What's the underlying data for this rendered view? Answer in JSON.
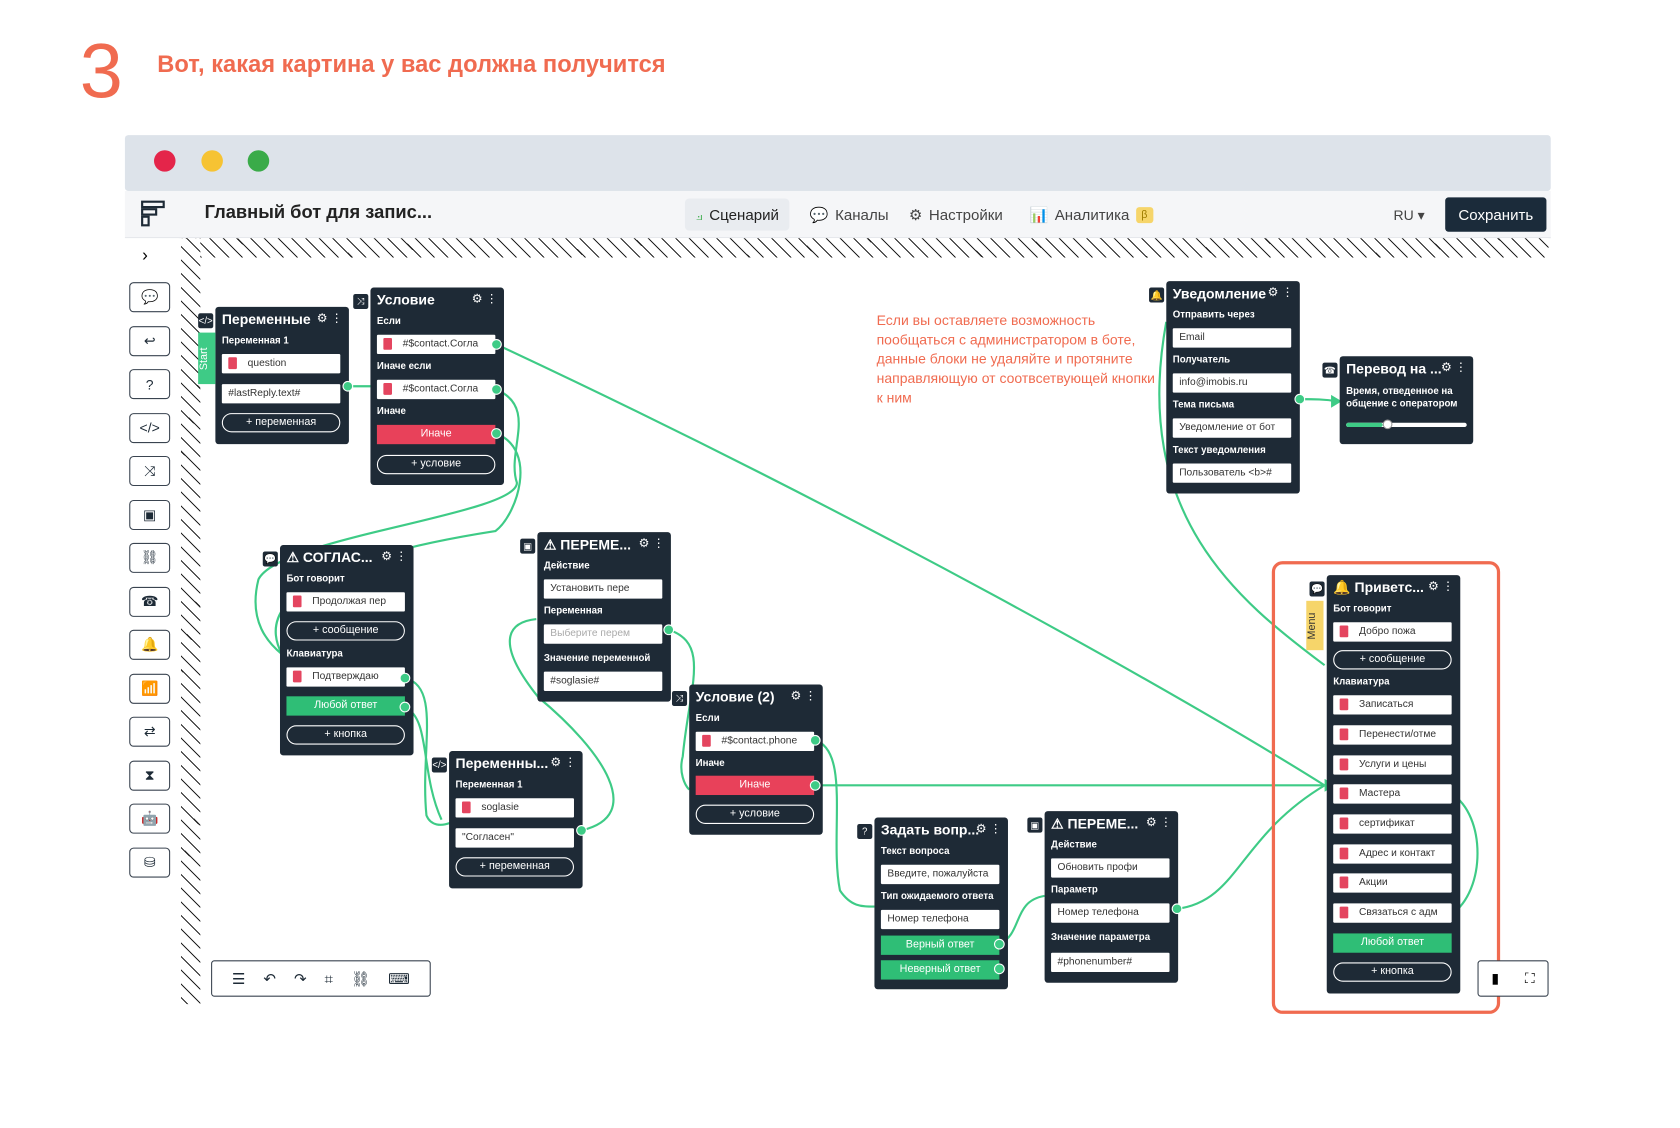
{
  "step": {
    "number": "3",
    "heading": "Вот, какая картина у вас должна получится"
  },
  "window": {
    "dots": [
      "#e4254a",
      "#f6c333",
      "#3aab49"
    ]
  },
  "app": {
    "title": "Главный бот для запис...",
    "tabs": [
      {
        "label": "Сценарий",
        "active": true,
        "icon": "scenario-icon"
      },
      {
        "label": "Каналы",
        "active": false,
        "icon": "chat-icon"
      },
      {
        "label": "Настройки",
        "active": false,
        "icon": "gear-icon"
      },
      {
        "label": "Аналитика",
        "active": false,
        "icon": "chart-icon",
        "badge": "β"
      }
    ],
    "lang": "RU",
    "save": "Сохранить"
  },
  "sidebar": [
    "›",
    "💬",
    "↩",
    "?",
    "</>",
    "⤨",
    "▣",
    "⛓",
    "☎",
    "🔔",
    "📶",
    "⇄",
    "⧗",
    "🤖",
    "⛁"
  ],
  "note": "Если вы оставляете возможность пообщаться с администратором в боте, данные блоки не удаляйте и протяните направляющую от соотвсетвующей кнопки к ним",
  "nodes": {
    "vars1": {
      "title": "Переменные",
      "label1": "Переменная 1",
      "f1": "question",
      "f2": "#lastReply.text#",
      "btn": "+ переменная",
      "flag": "Start"
    },
    "cond1": {
      "title": "Условие",
      "l_if": "Если",
      "f_if": "#$contact.Согла",
      "l_elif": "Иначе если",
      "f_elif": "#$contact.Согла",
      "l_else": "Иначе",
      "else": "Иначе",
      "btn": "+ условие"
    },
    "agree": {
      "title": "СОГЛАС...",
      "l1": "Бот говорит",
      "f1": "Продолжая пер",
      "btn1": "+ сообщение",
      "l2": "Клавиатура",
      "f2": "Подтверждаю",
      "any": "Любой ответ",
      "btn2": "+ кнопка"
    },
    "vars2": {
      "title": "ПЕРЕМЕ...",
      "l1": "Действие",
      "f1": "Установить пере",
      "l2": "Переменная",
      "f2": "Выберите перем",
      "l3": "Значение переменной",
      "f3": "#soglasie#"
    },
    "vars3": {
      "title": "Переменны...",
      "l1": "Переменная 1",
      "f1": "soglasie",
      "f2": "\"Согласен\"",
      "btn": "+ переменная"
    },
    "cond2": {
      "title": "Условие (2)",
      "l_if": "Если",
      "f_if": "#$contact.phone",
      "l_else": "Иначе",
      "else": "Иначе",
      "btn": "+ условие"
    },
    "ask": {
      "title": "Задать вопр...",
      "l1": "Текст вопроса",
      "f1": "Введите, пожалуйста",
      "l2": "Тип ожидаемого ответа",
      "f2": "Номер телефона",
      "ok": "Верный ответ",
      "bad": "Неверный ответ"
    },
    "vars4": {
      "title": "ПЕРЕМЕ...",
      "l1": "Действие",
      "f1": "Обновить профи",
      "l2": "Параметр",
      "f2": "Номер телефона",
      "l3": "Значение параметра",
      "f3": "#phonenumber#"
    },
    "notify": {
      "title": "Уведомление",
      "l1": "Отправить через",
      "f1": "Email",
      "l2": "Получатель",
      "f2": "info@imobis.ru",
      "l3": "Тема письма",
      "f3": "Уведомление от бот",
      "l4": "Текст уведомления",
      "f4": "Пользователь <b>#"
    },
    "transfer": {
      "title": "Перевод на ...",
      "l1": "Время, отведенное на общение с оператором"
    },
    "welcome": {
      "title": "Приветс...",
      "l1": "Бот говорит",
      "f1": "Добро пожа",
      "btn1": "+ сообщение",
      "l2": "Клавиатура",
      "buttons": [
        "Записаться",
        "Перенести/отме",
        "Услуги и цены",
        "Мастера",
        "сертификат",
        "Адрес и контакт",
        "Акции",
        "Связаться с адм"
      ],
      "any": "Любой ответ",
      "btn2": "+ кнопка",
      "flag": "Menu"
    }
  },
  "bottom_tools": [
    "☰",
    "↶",
    "↷",
    "⌗",
    "⛓",
    "⌨"
  ],
  "corner_tools": [
    "▮",
    "⛶"
  ]
}
